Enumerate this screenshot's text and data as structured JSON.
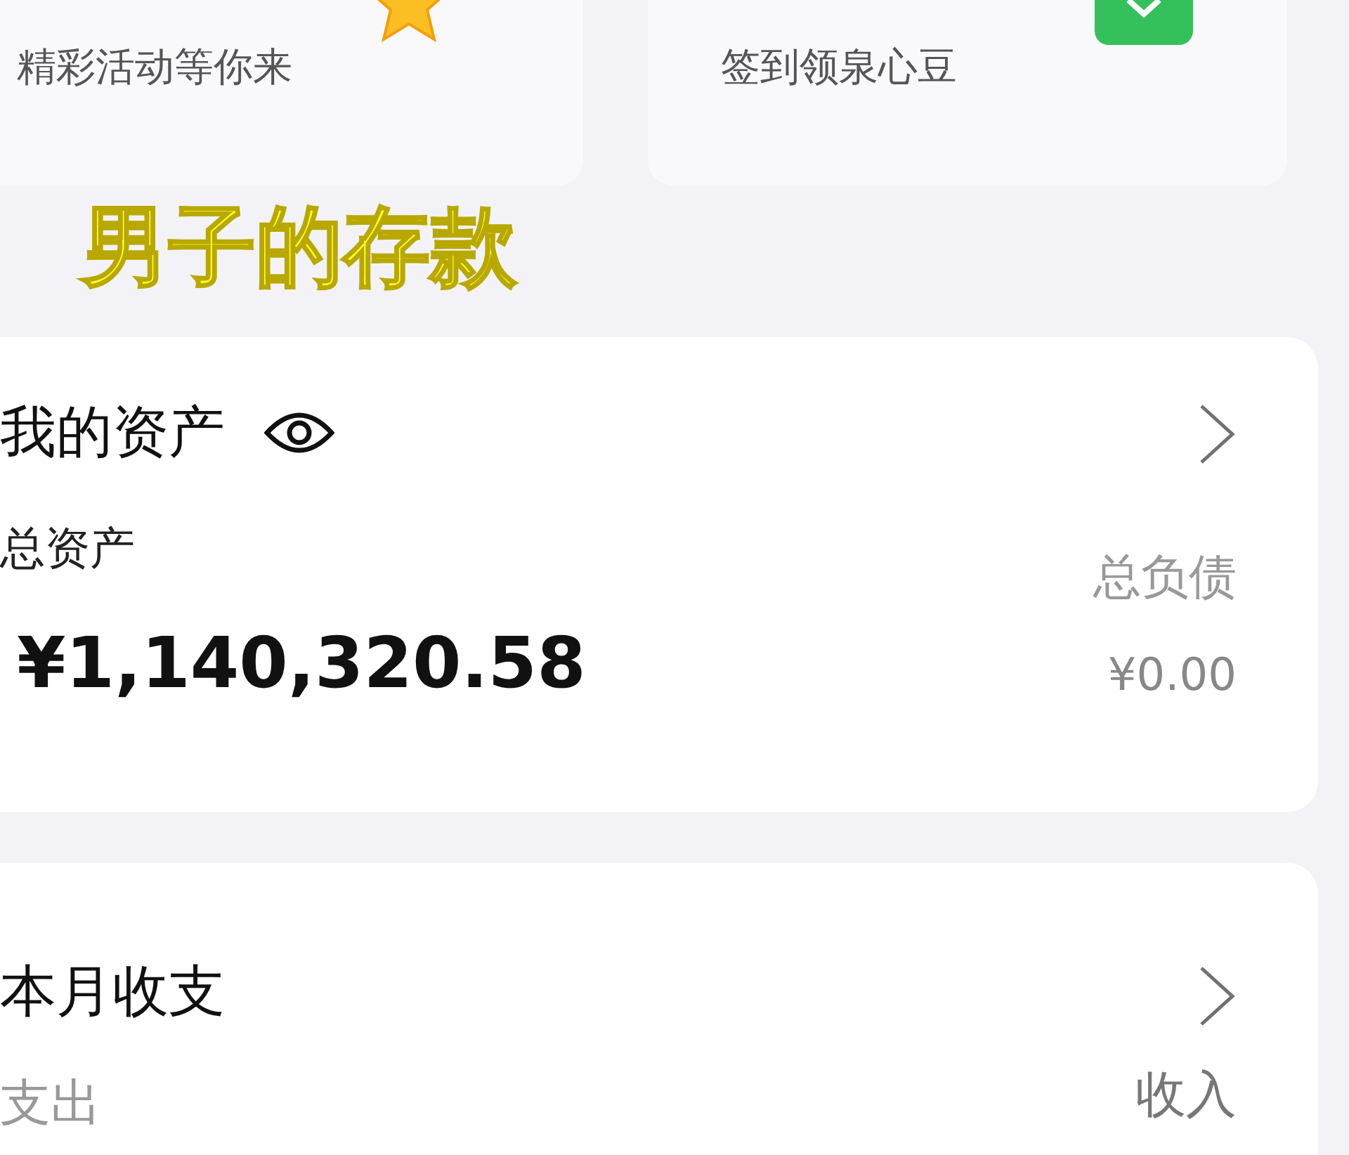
{
  "promo_cards": [
    {
      "label": "精彩活动等你来",
      "kind": "star"
    },
    {
      "label": "签到领泉心豆",
      "kind": "check"
    }
  ],
  "caption": "男子的存款",
  "assets": {
    "title": "我的资产",
    "total_label": "总资产",
    "total_value": "¥1,140,320.58",
    "debt_label": "总负债",
    "debt_value": "¥0.00"
  },
  "monthly": {
    "title": "本月收支",
    "expense_label": "支出",
    "income_label": "收入"
  }
}
